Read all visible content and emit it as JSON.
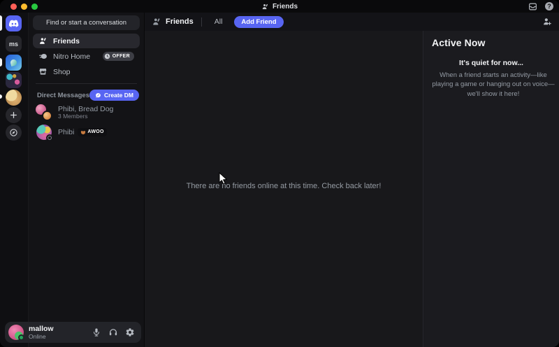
{
  "titlebar": {
    "title": "Friends"
  },
  "rail": {
    "server_initials": "ms"
  },
  "sidebar": {
    "search_placeholder": "Find or start a conversation",
    "nav": [
      {
        "label": "Friends"
      },
      {
        "label": "Nitro Home",
        "badge": "OFFER"
      },
      {
        "label": "Shop"
      }
    ],
    "dm_section_label": "Direct Messages",
    "create_dm_label": "Create DM",
    "dms": [
      {
        "name": "Phibi, Bread Dog",
        "subtitle": "3 Members"
      },
      {
        "name": "Phibi",
        "tag": "AWOO"
      }
    ]
  },
  "user_panel": {
    "username": "mallow",
    "status": "Online"
  },
  "header": {
    "title": "Friends",
    "tabs": [
      {
        "label": "All"
      }
    ],
    "add_friend_label": "Add Friend"
  },
  "main": {
    "empty_state": "There are no friends online at this time. Check back later!"
  },
  "active_now": {
    "title": "Active Now",
    "empty_title": "It's quiet for now...",
    "empty_body": "When a friend starts an activity—like playing a game or hanging out on voice—we'll show it here!"
  },
  "colors": {
    "accent": "#5865f2",
    "online": "#23a55a",
    "titlebar": "#0a0a0c"
  }
}
